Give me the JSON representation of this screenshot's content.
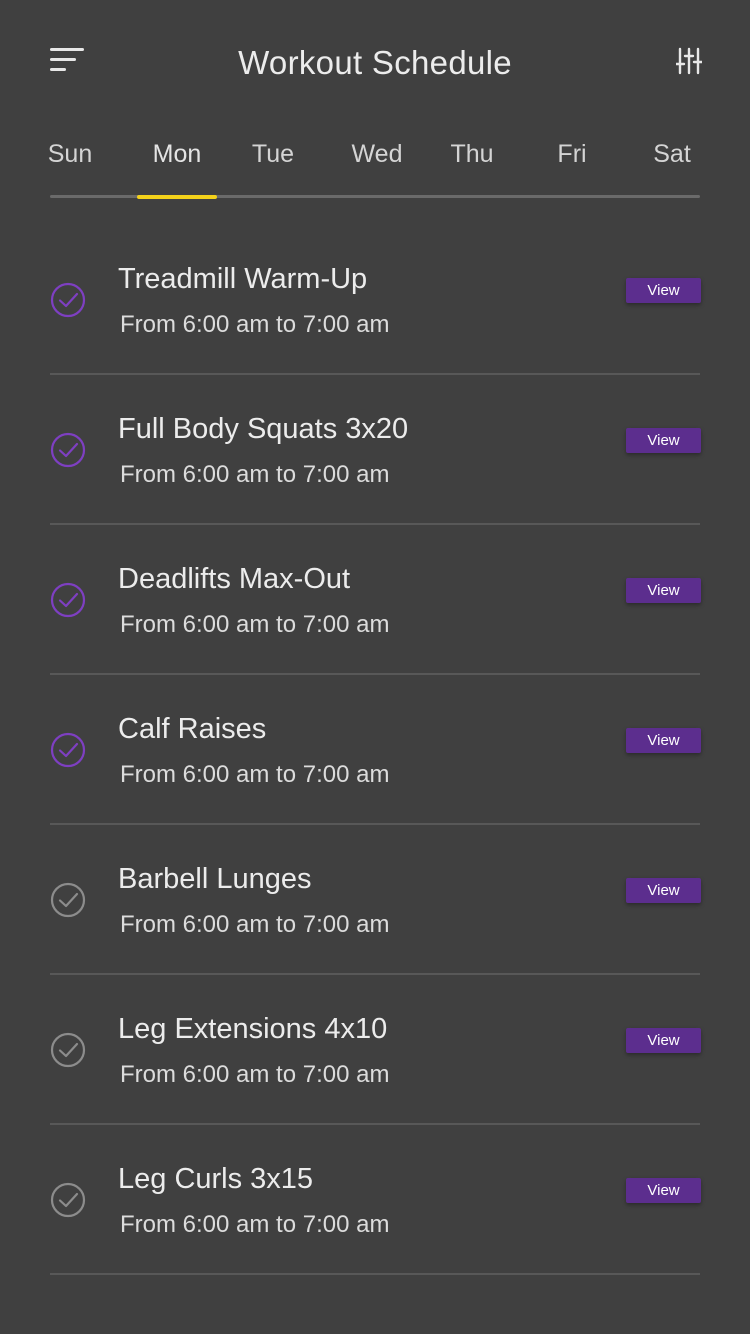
{
  "header": {
    "title": "Workout Schedule",
    "menu_icon": "sort-menu-icon",
    "filter_icon": "sliders-icon"
  },
  "days": [
    "Sun",
    "Mon",
    "Tue",
    "Wed",
    "Thu",
    "Fri",
    "Sat"
  ],
  "selected_day": "Mon",
  "colors": {
    "background": "#404040",
    "accent_indicator": "#f4d21a",
    "button": "#5c2e8e",
    "check_done": "#7e3fc2",
    "check_pending": "#8c8c8c"
  },
  "workouts": [
    {
      "title": "Treadmill Warm-Up",
      "time": "From 6:00 am to 7:00 am",
      "done": true,
      "button": "View"
    },
    {
      "title": "Full Body Squats 3x20",
      "time": "From 6:00 am to 7:00 am",
      "done": true,
      "button": "View"
    },
    {
      "title": "Deadlifts Max-Out",
      "time": "From 6:00 am to 7:00 am",
      "done": true,
      "button": "View"
    },
    {
      "title": "Calf Raises",
      "time": "From 6:00 am to 7:00 am",
      "done": true,
      "button": "View"
    },
    {
      "title": "Barbell Lunges",
      "time": "From 6:00 am to 7:00 am",
      "done": false,
      "button": "View"
    },
    {
      "title": "Leg Extensions 4x10",
      "time": "From 6:00 am to 7:00 am",
      "done": false,
      "button": "View"
    },
    {
      "title": "Leg Curls 3x15",
      "time": "From 6:00 am to 7:00 am",
      "done": false,
      "button": "View"
    }
  ]
}
